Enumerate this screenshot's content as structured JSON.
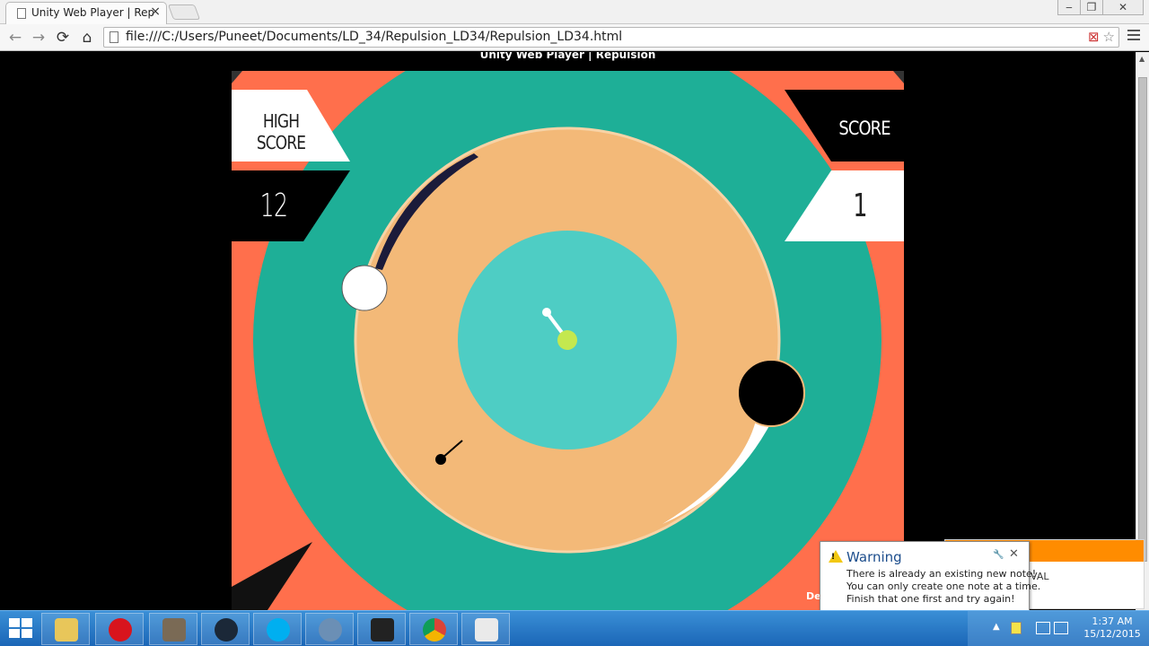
{
  "browser": {
    "tab_title": "Unity Web Player | Repulsi",
    "tab_close": "×",
    "url": "file:///C:/Users/Puneet/Documents/LD_34/Repulsion_LD34/Repulsion_LD34.html",
    "back": "←",
    "forward": "→",
    "reload": "⟳",
    "home": "⌂",
    "minimize": "‒",
    "restore": "❐",
    "close": "✕",
    "star": "☆",
    "blocked": "⊠"
  },
  "page": {
    "heading": "Unity Web Player | Repulsion",
    "footer_fragment": "De"
  },
  "game": {
    "high_score_label_line1": "HIGH",
    "high_score_label_line2": "SCORE",
    "high_score": "12",
    "score_label": "SCORE",
    "score": "1",
    "colors": {
      "background": "#ff6f4c",
      "outer_ring": "#1eaf97",
      "sand_ring": "#f3b978",
      "inner_core": "#4ecdc4",
      "player": "#c4e84f"
    }
  },
  "notification": {
    "title": "Warning",
    "line1": "There is already an existing new note!",
    "line2": "You can only create one note at a time.",
    "line3": "Finish that one first and try again!",
    "pin": "🔧",
    "close": "✕",
    "side_text": "VAL",
    "icon": "warning-triangle-icon"
  },
  "taskbar": {
    "apps": [
      "file-explorer",
      "opera",
      "gimp",
      "steam",
      "skype",
      "app-6",
      "unity",
      "chrome",
      "app-9"
    ],
    "clock_time": "1:37 AM",
    "clock_date": "15/12/2015"
  }
}
